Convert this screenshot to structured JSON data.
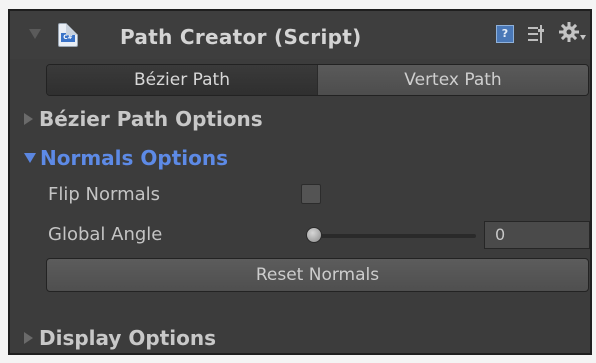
{
  "component": {
    "title": "Path Creator (Script)",
    "script_icon_label": "C#",
    "icons": [
      "fold-arrow-icon",
      "csharp-script-icon",
      "help-book-icon",
      "preset-icon",
      "gear-icon"
    ]
  },
  "path_type_toggle": {
    "options": [
      "Bézier Path",
      "Vertex Path"
    ],
    "selected": "Bézier Path"
  },
  "sections": {
    "bezier_options": {
      "label": "Bézier Path Options",
      "expanded": false
    },
    "normals_options": {
      "label": "Normals Options",
      "expanded": true
    },
    "display_options": {
      "label": "Display Options",
      "expanded": false
    }
  },
  "normals": {
    "flip_normals_label": "Flip Normals",
    "flip_normals_checked": false,
    "global_angle_label": "Global Angle",
    "global_angle_value": "0",
    "global_angle_fraction": 0,
    "reset_button_label": "Reset Normals"
  },
  "colors": {
    "panel_bg": "#3c3c3c",
    "active_foldout": "#5d8ae6",
    "text": "#c4c4c4"
  }
}
